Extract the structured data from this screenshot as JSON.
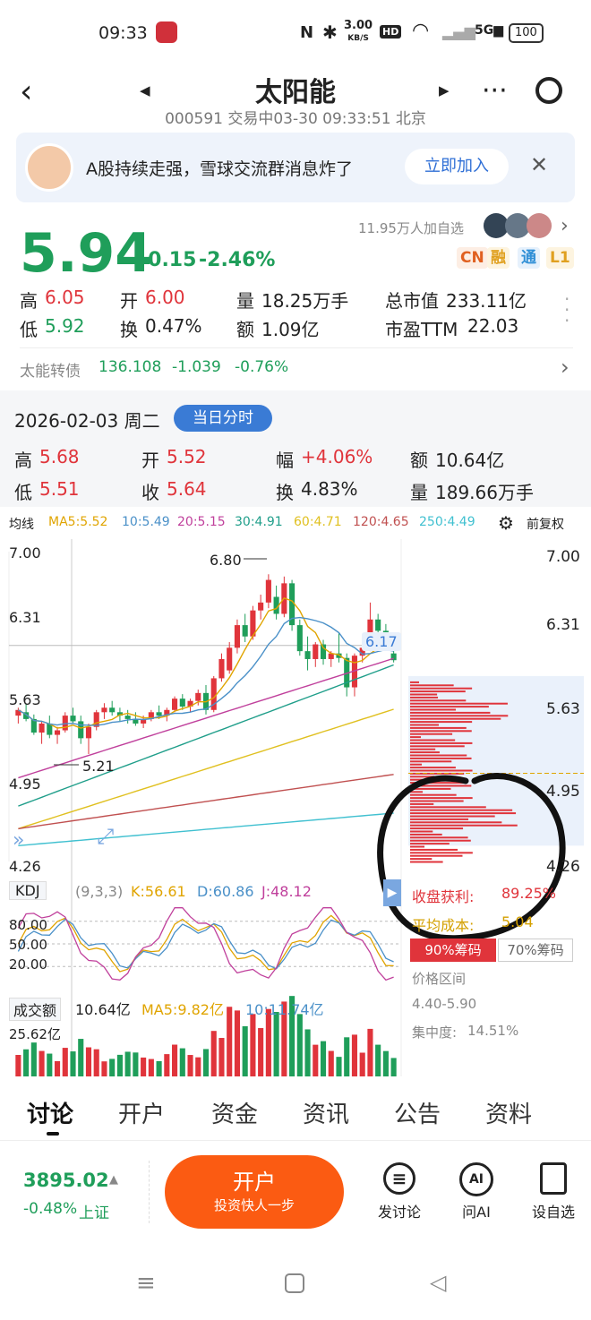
{
  "status": {
    "time": "09:33",
    "net_speed": "3.00",
    "net_unit": "KB/S",
    "battery": "100"
  },
  "header": {
    "title": "太阳能",
    "subtitle": "000591 交易中03-30 09:33:51 北京"
  },
  "banner": {
    "text": "A股持续走强，雪球交流群消息炸了",
    "button": "立即加入"
  },
  "quote": {
    "price": "5.94",
    "change": "-0.15",
    "change_pct": "-2.46%",
    "followers": "11.95万人加自选",
    "tags": [
      "CN",
      "融",
      "通",
      "L1"
    ],
    "high_label": "高",
    "high": "6.05",
    "open_label": "开",
    "open": "6.00",
    "vol_label": "量",
    "vol": "18.25万手",
    "mcap_label": "总市值",
    "mcap": "233.11亿",
    "low_label": "低",
    "low": "5.92",
    "turn_label": "换",
    "turn": "0.47%",
    "amt_label": "额",
    "amt": "1.09亿",
    "pe_label": "市盈TTM",
    "pe": "22.03",
    "bond_name": "太能转债",
    "bond_price": "136.108",
    "bond_chg": "-1.039",
    "bond_pct": "-0.76%"
  },
  "day": {
    "date": "2026-02-03 周二",
    "btn": "当日分时",
    "high_label": "高",
    "high": "5.68",
    "open_label": "开",
    "open": "5.52",
    "amp_label": "幅",
    "amp": "+4.06%",
    "amt_label": "额",
    "amt": "10.64亿",
    "low_label": "低",
    "low": "5.51",
    "close_label": "收",
    "close": "5.64",
    "turn_label": "换",
    "turn": "4.83%",
    "vol_label": "量",
    "vol": "189.66万手"
  },
  "ma": {
    "label": "均线",
    "ma5": "MA5:5.52",
    "ma10": "10:5.49",
    "ma20": "20:5.15",
    "ma30": "30:4.91",
    "ma60": "60:4.71",
    "ma120": "120:4.65",
    "ma250": "250:4.49",
    "adjust": "前复权",
    "colors": {
      "ma5": "#e0a400",
      "ma10": "#4a90c8",
      "ma20": "#c0409c",
      "ma30": "#1f9e8a",
      "ma60": "#e0c020",
      "ma120": "#c05050",
      "ma250": "#40c0d0"
    }
  },
  "chart_data": {
    "type": "candlestick",
    "y_axis_ticks": [
      "7.00",
      "6.31",
      "5.63",
      "4.95",
      "4.26"
    ],
    "right_axis_ticks": [
      "7.00",
      "6.31",
      "5.63",
      "4.95",
      "4.26"
    ],
    "ylim": [
      4.26,
      7.0
    ],
    "annotations": {
      "high": "6.80",
      "low": "5.21",
      "current": "6.17"
    },
    "candles": [
      [
        5.55,
        5.62,
        5.48,
        5.6
      ],
      [
        5.58,
        5.65,
        5.5,
        5.52
      ],
      [
        5.52,
        5.56,
        5.38,
        5.4
      ],
      [
        5.4,
        5.5,
        5.3,
        5.48
      ],
      [
        5.48,
        5.55,
        5.35,
        5.38
      ],
      [
        5.38,
        5.45,
        5.3,
        5.42
      ],
      [
        5.42,
        5.58,
        5.4,
        5.55
      ],
      [
        5.55,
        5.62,
        5.48,
        5.5
      ],
      [
        5.5,
        5.55,
        5.3,
        5.35
      ],
      [
        5.35,
        5.48,
        5.21,
        5.45
      ],
      [
        5.45,
        5.6,
        5.42,
        5.58
      ],
      [
        5.58,
        5.66,
        5.52,
        5.62
      ],
      [
        5.62,
        5.68,
        5.55,
        5.58
      ],
      [
        5.58,
        5.62,
        5.5,
        5.55
      ],
      [
        5.55,
        5.6,
        5.48,
        5.52
      ],
      [
        5.52,
        5.58,
        5.46,
        5.48
      ],
      [
        5.48,
        5.55,
        5.44,
        5.52
      ],
      [
        5.52,
        5.6,
        5.5,
        5.58
      ],
      [
        5.58,
        5.64,
        5.52,
        5.55
      ],
      [
        5.55,
        5.62,
        5.5,
        5.6
      ],
      [
        5.6,
        5.72,
        5.58,
        5.7
      ],
      [
        5.7,
        5.74,
        5.6,
        5.63
      ],
      [
        5.63,
        5.7,
        5.58,
        5.68
      ],
      [
        5.68,
        5.78,
        5.64,
        5.75
      ],
      [
        5.75,
        5.82,
        5.56,
        5.6
      ],
      [
        5.6,
        5.9,
        5.58,
        5.88
      ],
      [
        5.88,
        6.1,
        5.85,
        6.05
      ],
      [
        5.95,
        6.2,
        5.92,
        6.15
      ],
      [
        6.15,
        6.4,
        6.1,
        6.35
      ],
      [
        6.35,
        6.45,
        6.2,
        6.25
      ],
      [
        6.25,
        6.52,
        6.22,
        6.48
      ],
      [
        6.48,
        6.62,
        6.4,
        6.55
      ],
      [
        6.55,
        6.8,
        6.5,
        6.75
      ],
      [
        6.6,
        6.7,
        6.4,
        6.45
      ],
      [
        6.45,
        6.78,
        6.42,
        6.72
      ],
      [
        6.72,
        6.75,
        6.3,
        6.35
      ],
      [
        6.35,
        6.4,
        6.08,
        6.12
      ],
      [
        6.12,
        6.25,
        5.95,
        6.05
      ],
      [
        6.05,
        6.2,
        5.98,
        6.18
      ],
      [
        6.18,
        6.22,
        6.0,
        6.05
      ],
      [
        6.05,
        6.12,
        5.98,
        6.1
      ],
      [
        6.1,
        6.28,
        6.02,
        6.06
      ],
      [
        6.06,
        6.1,
        5.72,
        5.8
      ],
      [
        5.8,
        6.1,
        5.72,
        6.08
      ],
      [
        6.08,
        6.2,
        6.02,
        6.15
      ],
      [
        6.15,
        6.55,
        6.12,
        6.4
      ],
      [
        6.4,
        6.45,
        6.25,
        6.3
      ],
      [
        6.3,
        6.36,
        6.18,
        6.22
      ],
      [
        6.1,
        6.17,
        6.02,
        6.04
      ]
    ],
    "chip_stats": {
      "profit_label": "收盘获利:",
      "profit": "89.25%",
      "cost_label": "平均成本:",
      "cost": "5.04",
      "tab90": "90%筹码",
      "tab70": "70%筹码",
      "range_label": "价格区间",
      "range": "4.40-5.90",
      "conc_label": "集中度:",
      "conc": "14.51%"
    },
    "kdj": {
      "label": "KDJ",
      "params": "(9,3,3)",
      "k": "K:56.61",
      "d": "D:60.86",
      "j": "J:48.12",
      "levels": [
        "80.00",
        "50.00",
        "20.00"
      ]
    },
    "volume": {
      "label": "成交额",
      "value": "10.64亿",
      "ma5": "MA5:9.82亿",
      "ma10": "10:11.74亿",
      "max": "25.62亿"
    }
  },
  "tabs": [
    "讨论",
    "开户",
    "资金",
    "资讯",
    "公告",
    "资料"
  ],
  "bottom": {
    "index_value": "3895.02",
    "index_chg": "-0.48%",
    "index_name": "上证",
    "open_btn": "开户",
    "open_sub": "投资快人一步",
    "act1": "发讨论",
    "act2": "问AI",
    "act3": "设自选",
    "ai_glyph": "AI"
  }
}
